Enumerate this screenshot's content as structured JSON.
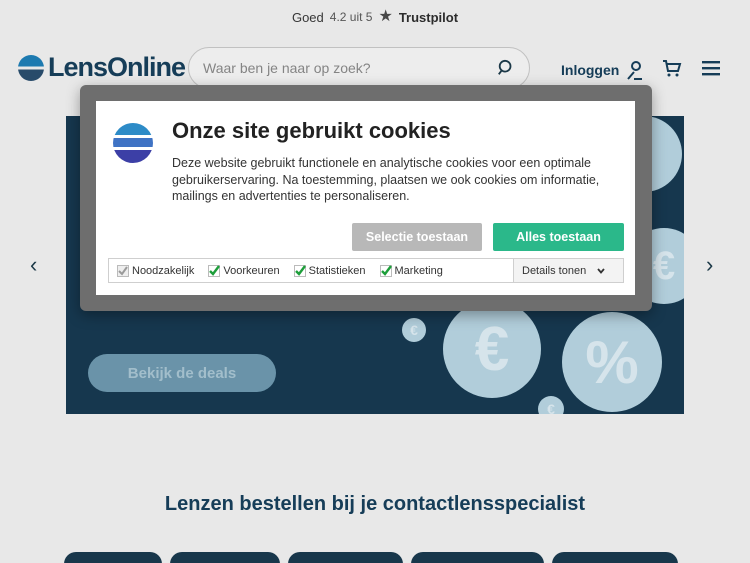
{
  "trustbar": {
    "label": "Goed",
    "rating": "4.2 uit 5",
    "brand": "Trustpilot"
  },
  "header": {
    "logo": "LensOnline",
    "search_placeholder": "Waar ben je naar op zoek?",
    "login_label": "Inloggen"
  },
  "hero": {
    "cta": "Bekijk de deals",
    "coin_symbols": [
      "€",
      "%",
      "€",
      "€",
      "€"
    ]
  },
  "section": {
    "title": "Lenzen bestellen bij je contactlensspecialist"
  },
  "cookie": {
    "title": "Onze site gebruikt cookies",
    "text": "Deze website gebruikt functionele en analytische cookies voor een optimale gebruikerservaring. Na toestemming, plaatsen we ook cookies om informatie, mailings en advertenties te personaliseren.",
    "btn_selection": "Selectie toestaan",
    "btn_all": "Alles toestaan",
    "options": [
      "Noodzakelijk",
      "Voorkeuren",
      "Statistieken",
      "Marketing"
    ],
    "details": "Details tonen"
  },
  "colors": {
    "accent_green": "#2bb88a",
    "brand_dark": "#17405c",
    "hero_bg": "#173a52"
  }
}
